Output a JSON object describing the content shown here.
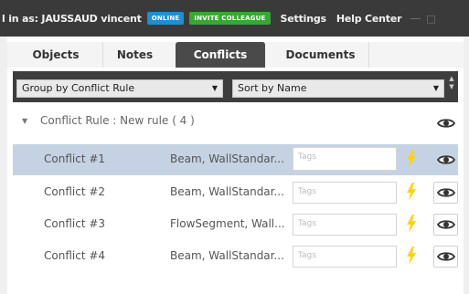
{
  "header": {
    "user_text": "l in as: JAUSSAUD vincent",
    "online_badge": "ONLINE",
    "invite_button": "INVITE COLLEAGUE",
    "settings_label": "Settings",
    "help_label": "Help Center",
    "colors": {
      "online": "#1e8fd1",
      "invite": "#3aa637",
      "bar": "#3a3a3a"
    }
  },
  "tabs": [
    {
      "label": "Objects"
    },
    {
      "label": "Notes"
    },
    {
      "label": "Conflicts",
      "active": true
    },
    {
      "label": "Documents"
    }
  ],
  "toolbar": {
    "group_select": "Group by Conflict Rule",
    "sort_select": "Sort by Name"
  },
  "group": {
    "label": "Conflict Rule : New rule ( 4 )"
  },
  "conflicts": [
    {
      "name": "Conflict #1",
      "elements": "Beam, WallStandar...",
      "tags_placeholder": "Tags",
      "selected": true
    },
    {
      "name": "Conflict #2",
      "elements": "Beam, WallStandar...",
      "tags_placeholder": "Tags",
      "selected": false
    },
    {
      "name": "Conflict #3",
      "elements": "FlowSegment, Wall...",
      "tags_placeholder": "Tags",
      "selected": false
    },
    {
      "name": "Conflict #4",
      "elements": "Beam, WallStandar...",
      "tags_placeholder": "Tags",
      "selected": false
    }
  ],
  "icons": {
    "row_status": "lightning-bolt-icon",
    "visibility": "eye-icon",
    "bolt_color": "#ffd21a"
  }
}
